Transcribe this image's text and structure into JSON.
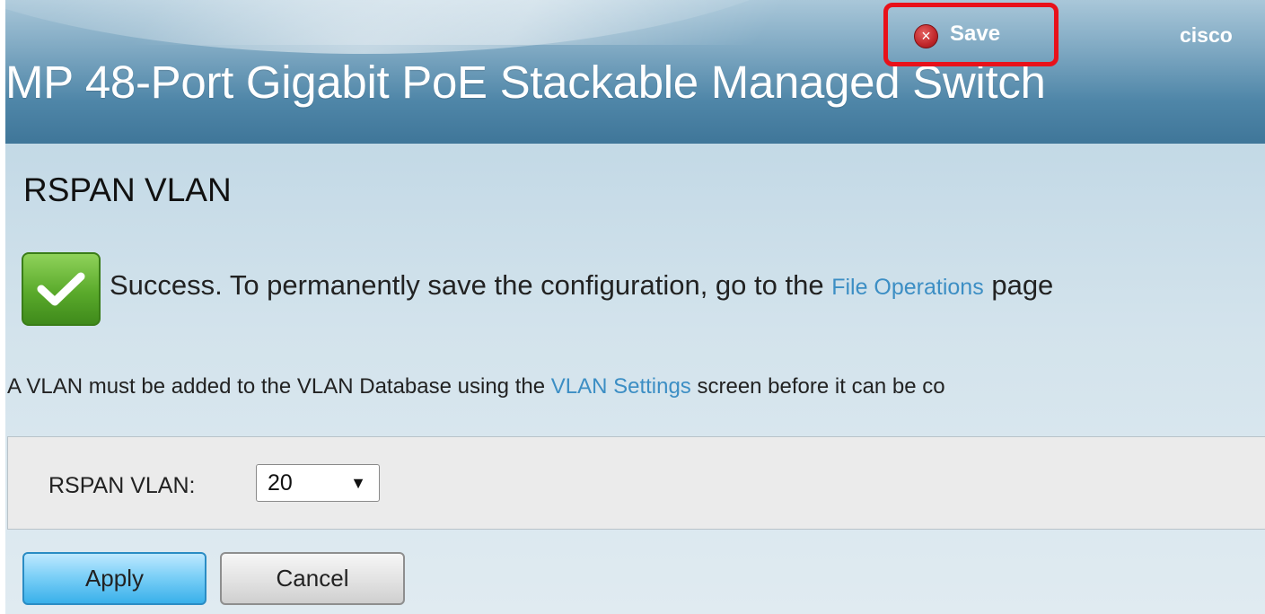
{
  "header": {
    "product_title": "MP 48-Port Gigabit PoE Stackable Managed Switch",
    "save_label": "Save",
    "save_icon": "close-circle-icon",
    "logo": "cisco"
  },
  "page": {
    "title": "RSPAN VLAN"
  },
  "success": {
    "icon": "checkmark-icon",
    "text_before": "Success. To permanently save the configuration, go to the ",
    "link": "File Operations",
    "text_after": " page"
  },
  "info": {
    "text_before": "A VLAN must be added to the VLAN Database using the ",
    "link": "VLAN Settings",
    "text_after": " screen before it can be co"
  },
  "form": {
    "rspan_label": "RSPAN VLAN:",
    "rspan_value": "20",
    "dropdown_arrow": "▼"
  },
  "buttons": {
    "apply": "Apply",
    "cancel": "Cancel"
  },
  "colors": {
    "highlight": "#e8111a",
    "link": "#3c8ec4",
    "success": "#5aaa2b"
  }
}
